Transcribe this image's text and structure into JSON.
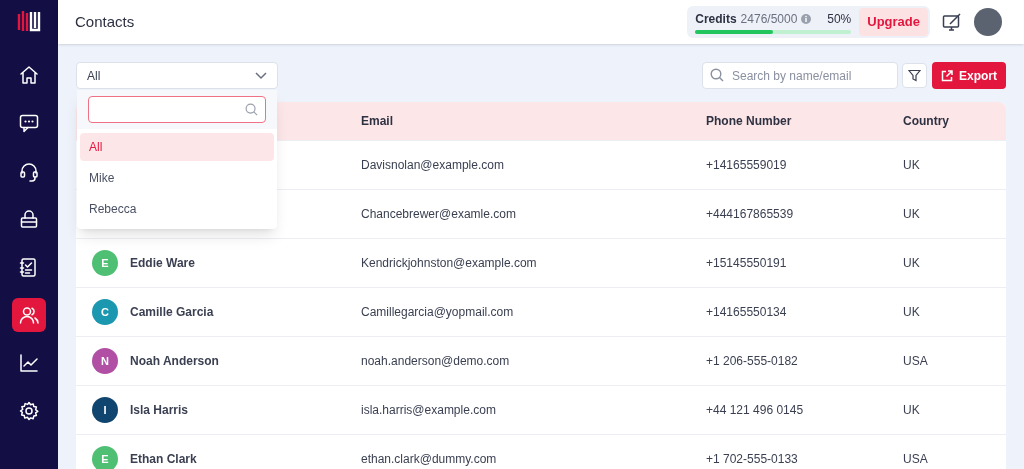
{
  "sidebar": {
    "items": [
      {
        "kind": "home",
        "selected": false
      },
      {
        "kind": "chat",
        "selected": false
      },
      {
        "kind": "headset",
        "selected": false
      },
      {
        "kind": "basket",
        "selected": false
      },
      {
        "kind": "checklist",
        "selected": false
      },
      {
        "kind": "users",
        "selected": true
      },
      {
        "kind": "chart",
        "selected": false
      },
      {
        "kind": "settings",
        "selected": false
      }
    ]
  },
  "header": {
    "title": "Contacts",
    "credits": {
      "label": "Credits",
      "value": "2476/5000",
      "percent": "50%",
      "level": 0.5
    },
    "upgrade": "Upgrade"
  },
  "filter": {
    "value": "All",
    "options": [
      {
        "label": "All",
        "selected": true
      },
      {
        "label": "Mike",
        "selected": false
      },
      {
        "label": "Rebecca",
        "selected": false
      }
    ]
  },
  "search": {
    "placeholder": "Search by name/email"
  },
  "export": "Export",
  "table": {
    "columns": [
      "Email",
      "Phone Number",
      "Country"
    ],
    "rows": [
      {
        "email": "Davisnolan@example.com",
        "phone": "+14165559019",
        "country": "UK"
      },
      {
        "email": "Chancebrewer@examle.com",
        "phone": "+444167865539",
        "country": "UK"
      },
      {
        "initial": "E",
        "color": "#4fbf73",
        "name": "Eddie Ware",
        "email": "Kendrickjohnston@example.com",
        "phone": "+15145550191",
        "country": "UK"
      },
      {
        "initial": "C",
        "color": "#1b97b0",
        "name": "Camille Garcia",
        "email": "Camillegarcia@yopmail.com",
        "phone": "+14165550134",
        "country": "UK"
      },
      {
        "initial": "N",
        "color": "#b04fa3",
        "name": "Noah Anderson",
        "email": "noah.anderson@demo.com",
        "phone": "+1 206-555-0182",
        "country": "USA"
      },
      {
        "initial": "I",
        "color": "#0f456e",
        "name": "Isla Harris",
        "email": "isla.harris@example.com",
        "phone": "+44 121 496 0145",
        "country": "UK"
      },
      {
        "initial": "E",
        "color": "#4fbf73",
        "name": "Ethan Clark",
        "email": "ethan.clark@dummy.com",
        "phone": "+1 702-555-0133",
        "country": "USA"
      }
    ]
  }
}
